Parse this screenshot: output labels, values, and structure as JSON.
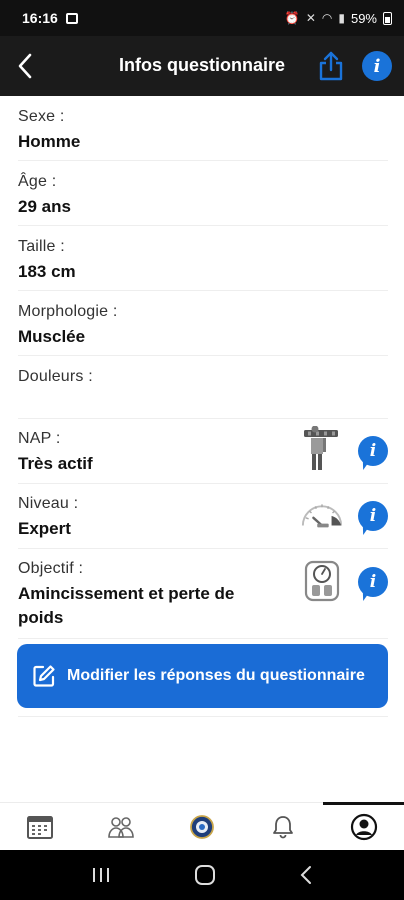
{
  "status_bar": {
    "time": "16:16",
    "battery": "59%"
  },
  "header": {
    "title": "Infos questionnaire"
  },
  "fields": {
    "sexe": {
      "label": "Sexe :",
      "value": "Homme"
    },
    "age": {
      "label": "Âge :",
      "value": "29 ans"
    },
    "taille": {
      "label": "Taille :",
      "value": "183 cm"
    },
    "morphologie": {
      "label": "Morphologie :",
      "value": "Musclée"
    },
    "douleurs": {
      "label": "Douleurs :",
      "value": ""
    },
    "nap": {
      "label": "NAP :",
      "value": "Très actif"
    },
    "niveau": {
      "label": "Niveau :",
      "value": "Expert"
    },
    "objectif": {
      "label": "Objectif :",
      "value": "Amincissement et perte de poids"
    }
  },
  "edit_button": {
    "label": "Modifier les réponses du questionnaire"
  },
  "icons": {
    "back": "back-arrow-icon",
    "share": "share-icon",
    "info": "info-icon",
    "nap": "worker-carrying-beam-icon",
    "niveau": "gauge-icon",
    "objectif": "scale-icon",
    "edit": "edit-icon",
    "nav": [
      "calendar-icon",
      "users-icon",
      "emblem-icon",
      "bell-icon",
      "profile-icon"
    ]
  },
  "colors": {
    "accent": "#1a6cd6",
    "app_bar": "#1b1b1b"
  }
}
